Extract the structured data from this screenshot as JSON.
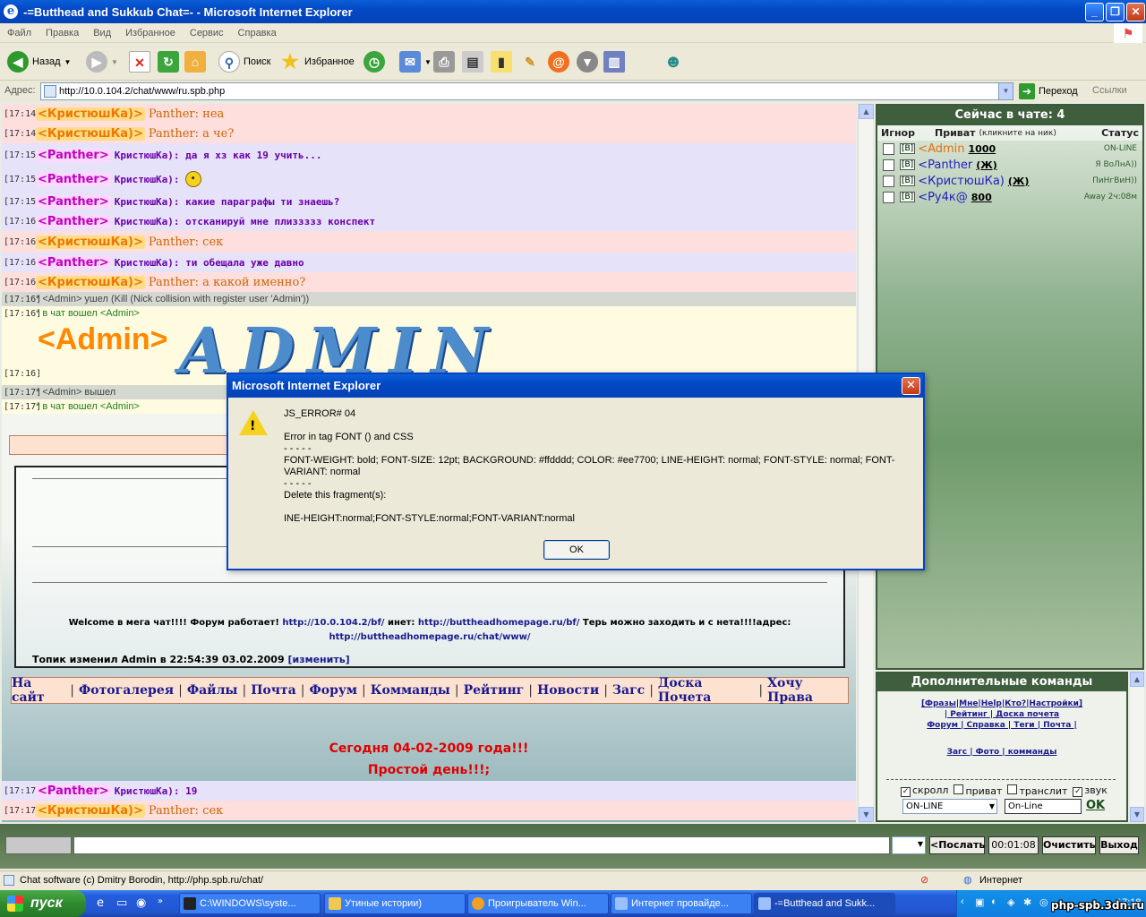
{
  "window": {
    "title": "-=Butthead and Sukkub Chat=- - Microsoft Internet Explorer"
  },
  "menu": [
    "Файл",
    "Правка",
    "Вид",
    "Избранное",
    "Сервис",
    "Справка"
  ],
  "toolbar": {
    "back": "Назад",
    "search": "Поиск",
    "favorites": "Избранное"
  },
  "address": {
    "label": "Адрес:",
    "url": "http://10.0.104.2/chat/www/ru.spb.php",
    "go": "Переход",
    "links": "Ссылки"
  },
  "chat": {
    "messages": [
      {
        "time": "[17:14]",
        "nick": "<КристюшКа)>",
        "text": "Panther: неа",
        "who": "k"
      },
      {
        "time": "[17:14]",
        "nick": "<КристюшКа)>",
        "text": "Panther: а че?",
        "who": "k"
      },
      {
        "time": "[17:15]",
        "nick": "<Panther>",
        "text": "КристюшКа): да я хз как 19 учить...",
        "who": "p"
      },
      {
        "time": "[17:15]",
        "nick": "<Panther>",
        "text": "КристюшКа):",
        "who": "p"
      },
      {
        "time": "[17:15]",
        "nick": "<Panther>",
        "text": "КристюшКа): какие параграфы ти знаешь?",
        "who": "p"
      },
      {
        "time": "[17:16]",
        "nick": "<Panther>",
        "text": "КристюшКа): отсканируй мне плиззззз конспект",
        "who": "p"
      },
      {
        "time": "[17:16]",
        "nick": "<КристюшКа)>",
        "text": "Panther: сек",
        "who": "k"
      },
      {
        "time": "[17:16]",
        "nick": "<Panther>",
        "text": "КристюшКа): ти обещала уже давно",
        "who": "p"
      },
      {
        "time": "[17:16]",
        "nick": "<КристюшКа)>",
        "text": "Panther: а какой именно?",
        "who": "k"
      }
    ],
    "sys1": {
      "time": "[17:16]",
      "text": "* <Admin> ушел (Kill (Nick collision with register user 'Admin'))"
    },
    "sys2": {
      "time": "[17:16]",
      "text": "* в чат вошел <Admin>"
    },
    "admin_time": "[17:16]",
    "admin_nick": "<Admin>",
    "admin_logo": "ADMIN",
    "sys3": {
      "time": "[17:17]",
      "text": "* <Admin> вышел"
    },
    "sys4": {
      "time": "[17:17]",
      "text": "* в чат вошел <Admin>"
    },
    "welcome_1": "Welcome в мега чат!!!! Форум работает!",
    "welcome_link1": "http://10.0.104.2/bf/",
    "welcome_2": "инет:",
    "welcome_link2": "http://buttheadhomepage.ru/bf/",
    "welcome_3": "Терь можно заходить и с нета!!!!адрес:",
    "welcome_link3": "http://buttheadhomepage.ru/chat/www/",
    "topic": "Топик изменил Admin в 22:54:39 03.02.2009",
    "topic_link": "[изменить]",
    "nav": [
      "На сайт",
      "Фотогалерея",
      "Файлы",
      "Почта",
      "Форум",
      "Комманды",
      "Рейтинг",
      "Новости",
      "Загс",
      "Доска Почета",
      "Хочу Права"
    ],
    "today_1": "Сегодня 04-02-2009 года!!!",
    "today_2": "Простой день!!!;",
    "last": [
      {
        "time": "[17:17]",
        "nick": "<Panther>",
        "text": "КристюшКа): 19",
        "who": "p"
      },
      {
        "time": "[17:17]",
        "nick": "<КристюшКа)>",
        "text": "Panther: сек",
        "who": "k"
      }
    ]
  },
  "sidebar": {
    "title": "Сейчас в чате: 4",
    "cols": {
      "ignore": "Игнор",
      "private": "Приват",
      "private_hint": "(кликните на ник)",
      "status": "Статус"
    },
    "users": [
      {
        "b": "[В]",
        "nick": "<Admin",
        "score": "1000",
        "status": "ON-LINE",
        "color": "#e07010"
      },
      {
        "b": "[В]",
        "nick": "<Panther",
        "score": "(Ж)",
        "status": "Я ВоЛнА))",
        "color": "#2020c0"
      },
      {
        "b": "[В]",
        "nick": "<КристюшКа)",
        "score": "(Ж)",
        "status": "ПиНгВиН))",
        "color": "#2020c0"
      },
      {
        "b": "[В]",
        "nick": "<Ру4к@",
        "score": "800",
        "status": "Away 2ч:08м",
        "color": "#2020c0"
      }
    ]
  },
  "commands": {
    "title": "Дополнительные команды",
    "line1": "[Фразы|Мне|Help|Кто?|Настройки]",
    "line2": "| Рейтинг | Доска почета",
    "line3": "Форум | Справка | Теги | Почта |",
    "line4": "Загс | Фото | комманды",
    "opt_scroll": "скролл",
    "opt_private": "приват",
    "opt_translit": "транслит",
    "opt_sound": "звук",
    "status_select": "ON-LINE",
    "status_input": "On-Line",
    "ok": "OK"
  },
  "input": {
    "send": "<Послать",
    "timer": "00:01:08",
    "clear": "Очистить",
    "exit": "Выход"
  },
  "statusbar": {
    "text": "Chat software (c) Dmitry Borodin, http://php.spb.ru/chat/",
    "zone": "Интернет"
  },
  "taskbar": {
    "start": "пуск",
    "tasks": [
      "C:\\WINDOWS\\syste...",
      "Утиные истории)",
      "Проигрыватель Win...",
      "Интернет провайде...",
      "-=Butthead and Sukk..."
    ],
    "clock": "17:18",
    "watermark": "php-spb.3dn.ru"
  },
  "dialog": {
    "title": "Microsoft Internet Explorer",
    "text": "JS_ERROR# 04\n\nError in tag FONT () and CSS\n- - - - -\nFONT-WEIGHT: bold; FONT-SIZE: 12pt; BACKGROUND: #ffdddd; COLOR: #ee7700; LINE-HEIGHT: normal; FONT-STYLE: normal; FONT-VARIANT: normal\n- - - - -\nDelete this fragment(s):\n\nINE-HEIGHT:normal;FONT-STYLE:normal;FONT-VARIANT:normal",
    "ok": "OK"
  }
}
